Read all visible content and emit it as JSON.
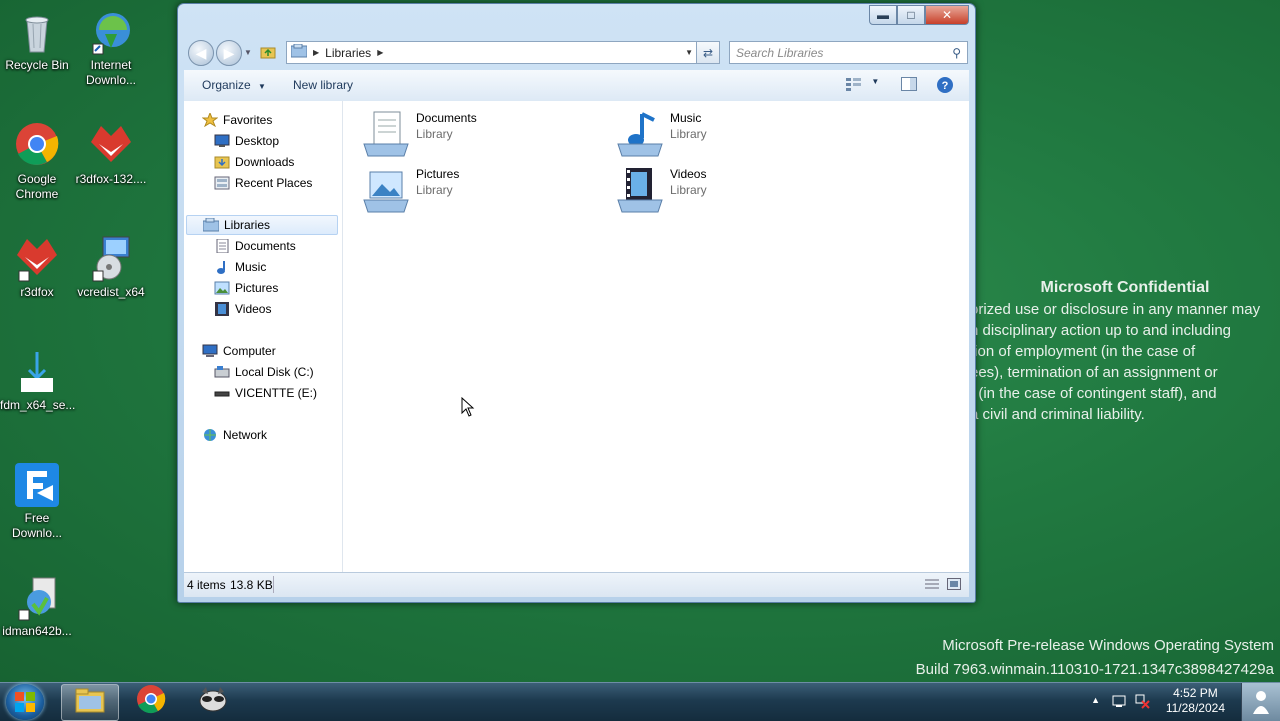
{
  "desktop": {
    "icons": [
      {
        "label": "Recycle Bin",
        "icon": "recycle-bin-icon"
      },
      {
        "label": "Internet Downlo...",
        "icon": "internet-download-manager-icon"
      },
      {
        "label": "Google Chrome",
        "icon": "chrome-icon"
      },
      {
        "label": "r3dfox-132....",
        "icon": "r3dfox-icon"
      },
      {
        "label": "r3dfox",
        "icon": "r3dfox-icon"
      },
      {
        "label": "vcredist_x64",
        "icon": "installer-icon"
      },
      {
        "label": "fdm_x64_se...",
        "icon": "download-icon"
      },
      {
        "label": "Free Downlo...",
        "icon": "free-download-manager-icon"
      },
      {
        "label": "idman642b...",
        "icon": "idm-installer-icon"
      }
    ],
    "watermark": {
      "title": "Microsoft Confidential",
      "lines": [
        "orized use or disclosure in any manner may",
        "n disciplinary action up to and including",
        "tion of employment (in the case of",
        "ees), termination of an assignment or",
        "t (in the case of contingent staff), and",
        "a civil and criminal liability."
      ]
    },
    "build": {
      "line1": "Microsoft Pre-release Windows Operating System",
      "line2": "Build 7963.winmain.110310-1721.1347c3898427429a"
    }
  },
  "explorer": {
    "address": {
      "crumb": "Libraries"
    },
    "search_placeholder": "Search Libraries",
    "toolbar": {
      "organize": "Organize",
      "new_library": "New library"
    },
    "nav": {
      "favorites": "Favorites",
      "favorites_items": [
        "Desktop",
        "Downloads",
        "Recent Places"
      ],
      "libraries": "Libraries",
      "libraries_items": [
        "Documents",
        "Music",
        "Pictures",
        "Videos"
      ],
      "computer": "Computer",
      "computer_items": [
        "Local Disk (C:)",
        "VICENTTE (E:)"
      ],
      "network": "Network"
    },
    "libraries": [
      {
        "name": "Documents",
        "type": "Library"
      },
      {
        "name": "Music",
        "type": "Library"
      },
      {
        "name": "Pictures",
        "type": "Library"
      },
      {
        "name": "Videos",
        "type": "Library"
      }
    ],
    "status": {
      "count": "4 items",
      "size": "13.8 KB"
    }
  },
  "taskbar": {
    "time": "4:52 PM",
    "date": "11/28/2024"
  },
  "colors": {
    "desktop": "#217a41",
    "window_frame": "#b7d1ea",
    "taskbar": "#1d3a4f"
  }
}
